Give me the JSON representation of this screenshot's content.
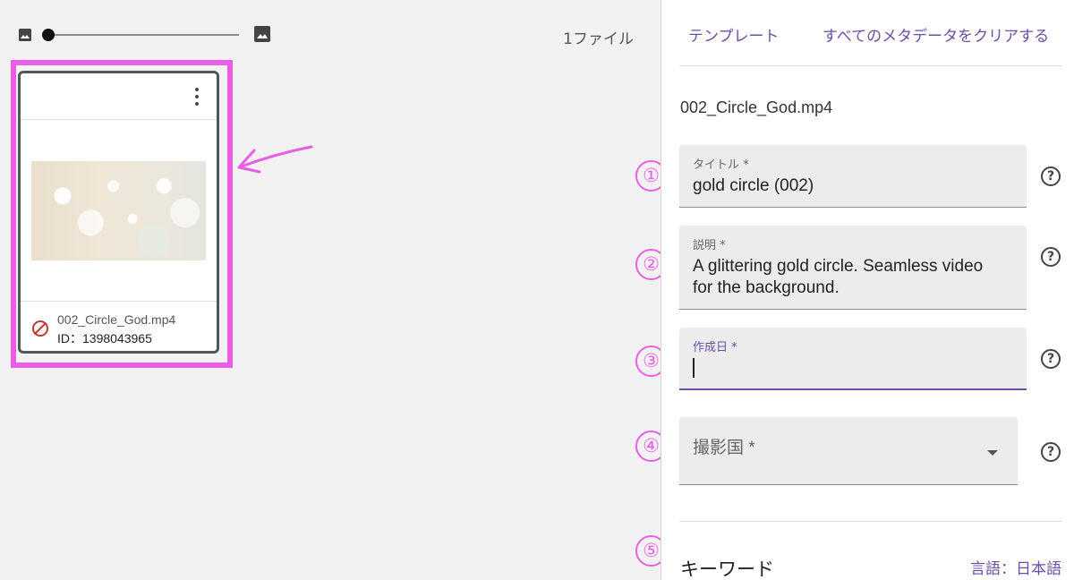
{
  "toolbar": {
    "file_count": "1ファイル",
    "zoom_small_icon": "image-icon",
    "zoom_large_icon": "image-icon"
  },
  "card": {
    "filename": "002_Circle_God.mp4",
    "id": "ID：1398043965",
    "status_icon": "prohibited-icon",
    "menu_icon": "kebab-menu-icon"
  },
  "panel": {
    "template_label": "テンプレート",
    "clear_label": "すべてのメタデータをクリアする",
    "filename": "002_Circle_God.mp4",
    "fields": {
      "title": {
        "label": "タイトル *",
        "value": "gold circle (002)"
      },
      "description": {
        "label": "説明 *",
        "value": "A glittering gold circle. Seamless video for the background."
      },
      "date": {
        "label": "作成日 *",
        "value": ""
      },
      "country": {
        "placeholder": "撮影国 *"
      }
    },
    "help_icon": "?",
    "keywords_title": "キーワード",
    "language": "言語：日本語"
  },
  "annotations": {
    "n1": "①",
    "n2": "②",
    "n3": "③",
    "n4": "④",
    "n5": "⑤"
  },
  "colors": {
    "accent": "#6a4fa8",
    "highlight": "#ea5ee7",
    "error": "#c0392b"
  }
}
